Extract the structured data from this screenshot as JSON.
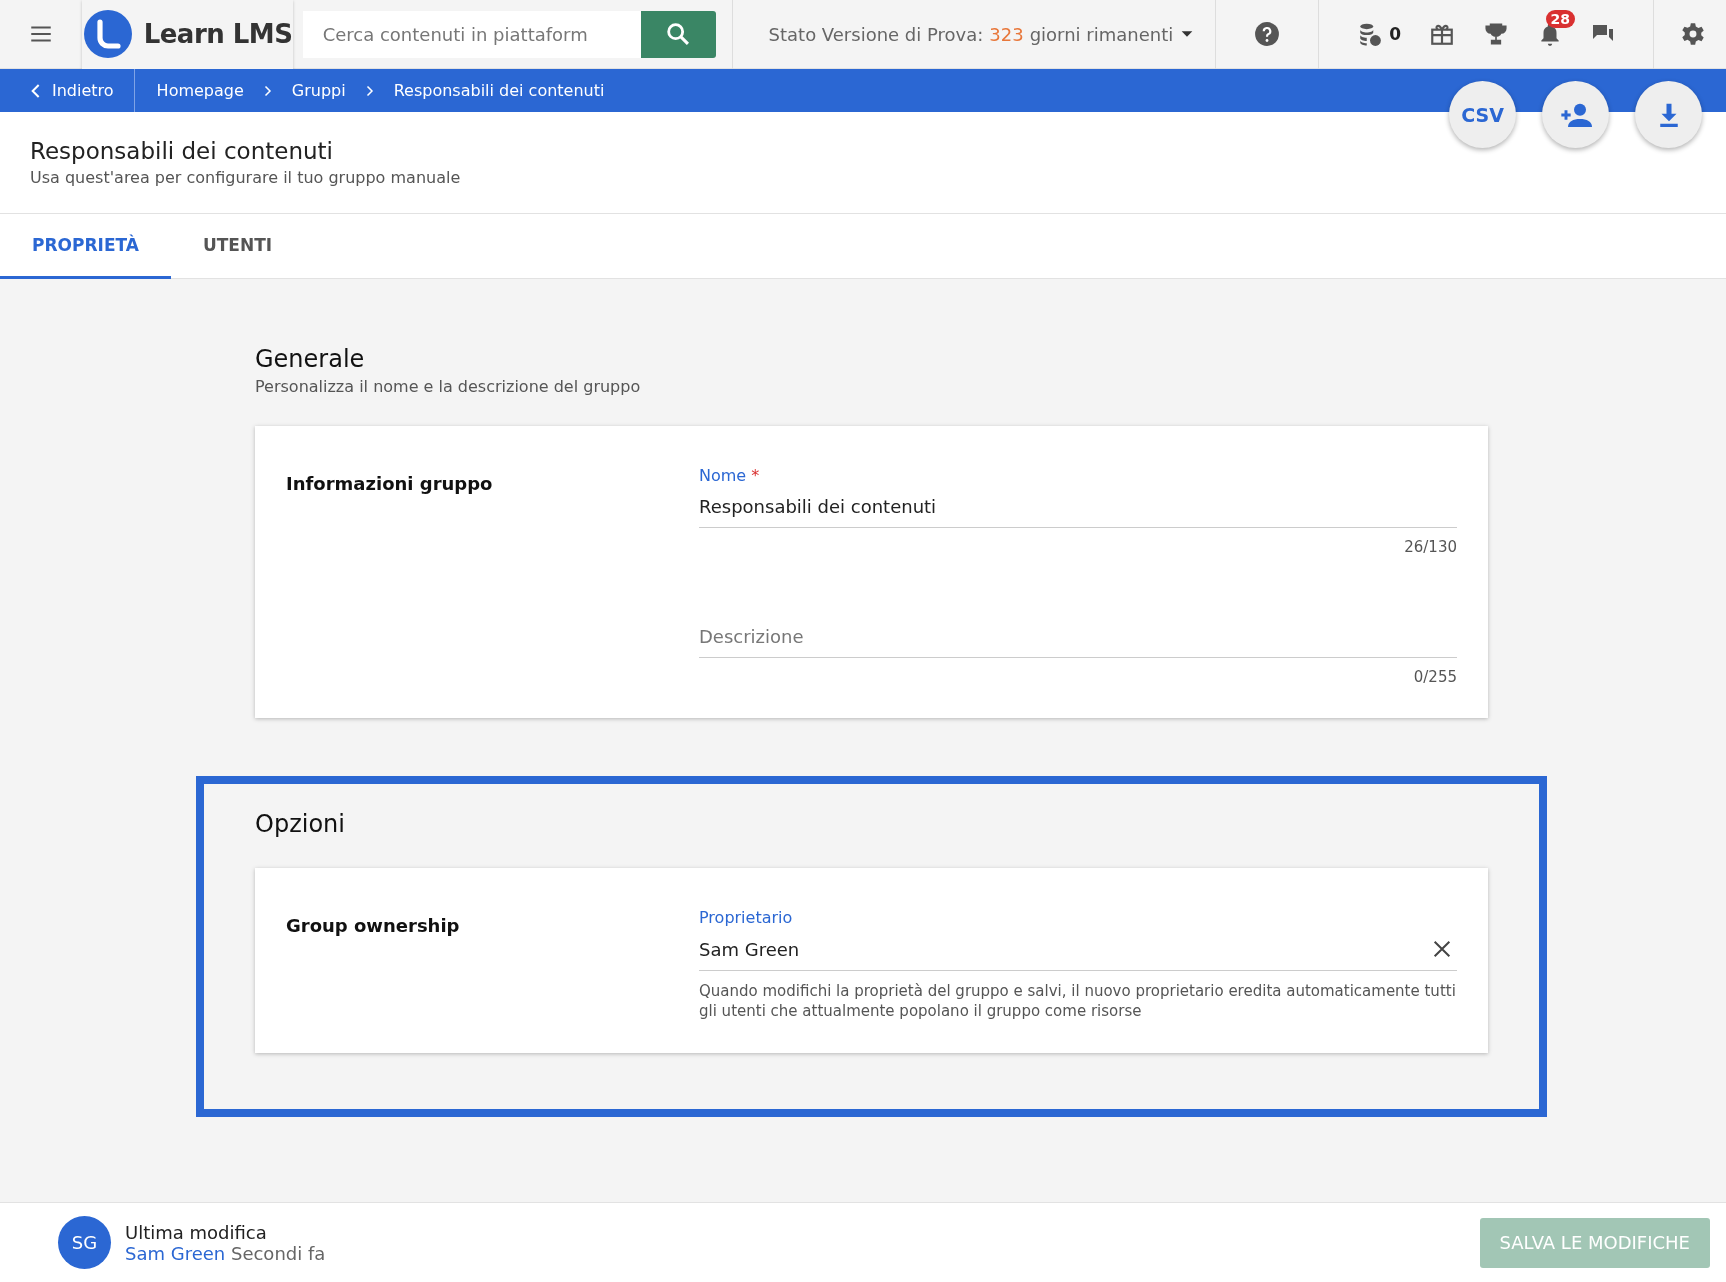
{
  "topbar": {
    "logo_text": "Learn LMS",
    "search": {
      "placeholder": "Cerca contenuti in piattaform"
    },
    "trial": {
      "prefix": "Stato Versione di Prova:",
      "days": "323",
      "suffix": "giorni rimanenti"
    },
    "coins": "0",
    "notifications": "28"
  },
  "breadcrumb": {
    "back": "Indietro",
    "items": [
      {
        "label": "Homepage"
      },
      {
        "label": "Gruppi"
      },
      {
        "label": "Responsabili dei contenuti"
      }
    ]
  },
  "actions": [
    {
      "kind": "csv",
      "label": "CSV"
    },
    {
      "kind": "add-user"
    },
    {
      "kind": "download"
    }
  ],
  "header": {
    "title": "Responsabili dei contenuti",
    "subtitle": "Usa quest'area per configurare il tuo gruppo manuale"
  },
  "tabs": [
    {
      "label": "PROPRIETÀ",
      "selected": true
    },
    {
      "label": "UTENTI",
      "selected": false
    }
  ],
  "sections": [
    {
      "title": "Generale",
      "subtitle": "Personalizza il nome e la descrizione del gruppo",
      "highlighted": false,
      "card": {
        "label": "Informazioni gruppo",
        "fields": [
          {
            "kind": "text",
            "label": "Nome",
            "required_mark": "*",
            "value": "Responsabili dei contenuti",
            "counter": "26/130"
          },
          {
            "kind": "text",
            "placeholder": "Descrizione",
            "counter": "0/255"
          }
        ]
      }
    },
    {
      "title": "Opzioni",
      "highlighted": true,
      "card": {
        "label": "Group ownership",
        "fields": [
          {
            "kind": "select",
            "label": "Proprietario",
            "value": "Sam Green",
            "helper": "Quando modifichi la proprietà del gruppo e salvi, il nuovo proprietario eredita automaticamente tutti gli utenti che attualmente popolano il gruppo come risorse"
          }
        ]
      }
    }
  ],
  "footer": {
    "avatar": "SG",
    "title": "Ultima modifica",
    "user": "Sam Green",
    "time": "Secondi fa",
    "save": {
      "label": "SALVA LE MODIFICHE",
      "disabled": true
    }
  }
}
